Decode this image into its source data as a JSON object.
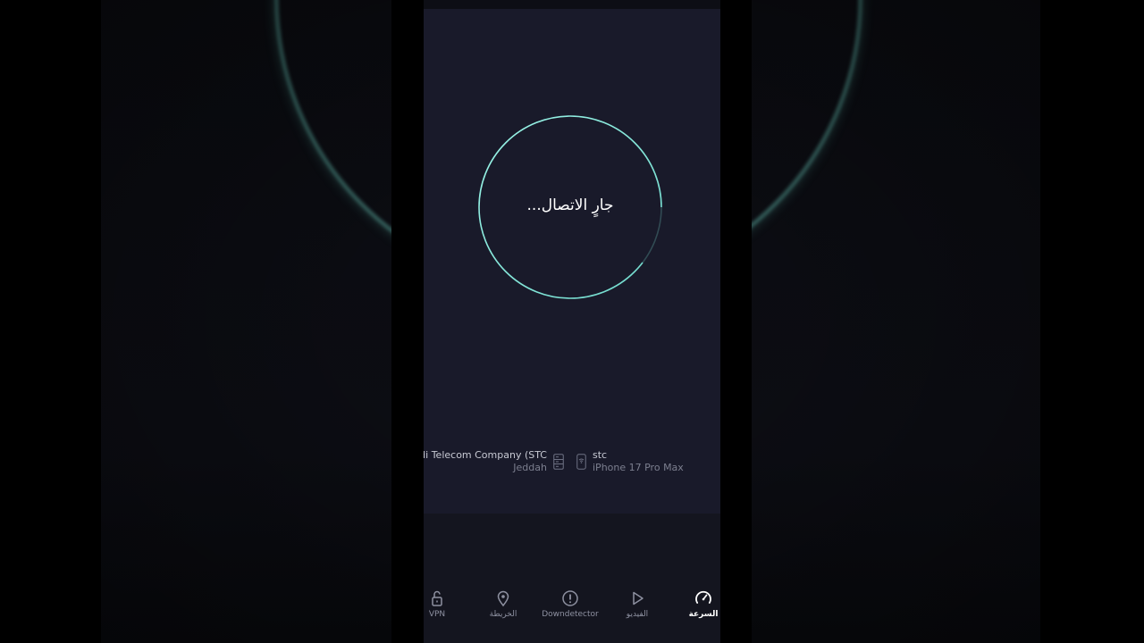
{
  "status": {
    "connecting_text": "جارٍ الاتصال..."
  },
  "server": {
    "isp_name": "Saudi Telecom Company (STC",
    "city": "Jeddah",
    "icon": "server-icon"
  },
  "device": {
    "carrier": "stc",
    "model": "iPhone 17 Pro Max",
    "icon": "phone-wifi-icon"
  },
  "nav": {
    "items": [
      {
        "label": "VPN",
        "icon": "lock-icon",
        "active": false
      },
      {
        "label": "الخريطة",
        "icon": "map-pin-icon",
        "active": false
      },
      {
        "label": "Downdetector",
        "icon": "alert-icon",
        "active": false
      },
      {
        "label": "الفيديو",
        "icon": "play-icon",
        "active": false
      },
      {
        "label": "السرعة",
        "icon": "speedometer-icon",
        "active": true
      }
    ]
  },
  "colors": {
    "accent": "#8ef0e0",
    "background": "#191a2a",
    "nav_inactive": "#8e91a1",
    "nav_active": "#ffffff"
  }
}
